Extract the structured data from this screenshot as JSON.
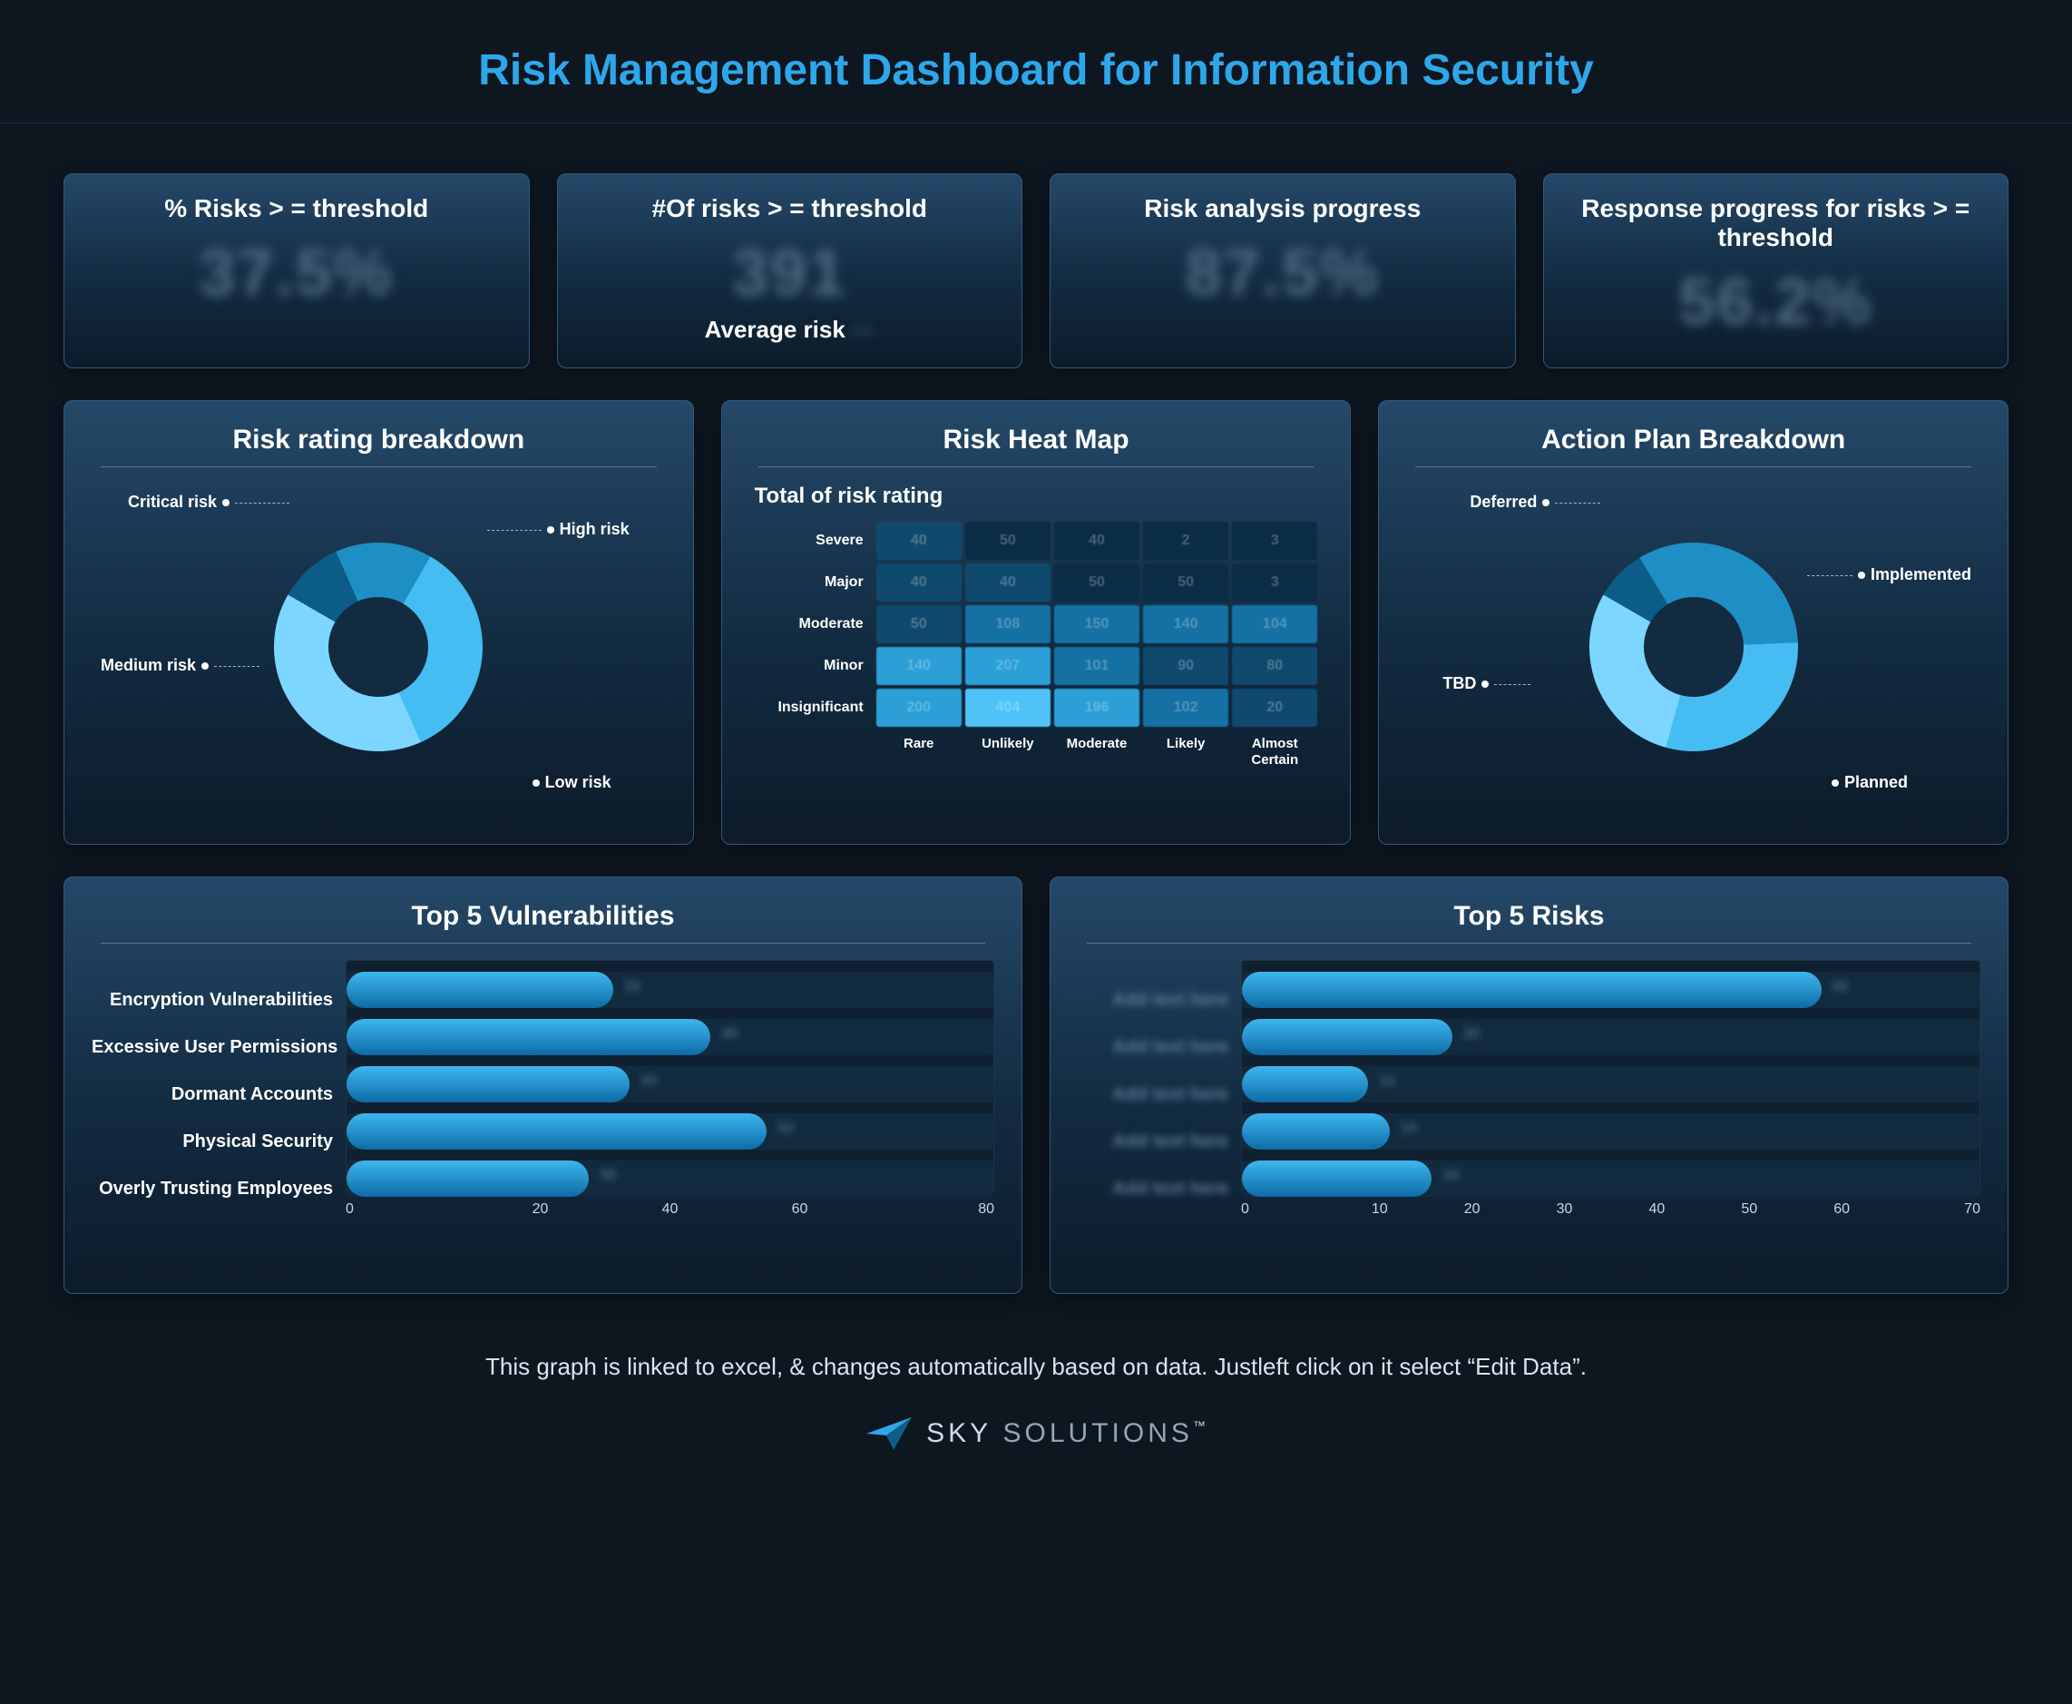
{
  "title": "Risk Management Dashboard for Information Security",
  "kpis": [
    {
      "label": "% Risks > = threshold",
      "value": "37.5%"
    },
    {
      "label": "#Of risks > = threshold",
      "value": "391",
      "sub_label": "Average risk",
      "sub_value": "—"
    },
    {
      "label": "Risk analysis progress",
      "value": "87.5%"
    },
    {
      "label": "Response progress for risks > = threshold",
      "value": "56.2%"
    }
  ],
  "risk_rating": {
    "title": "Risk rating breakdown",
    "segments": [
      {
        "name": "Critical risk",
        "pct": 10
      },
      {
        "name": "High risk",
        "pct": 15
      },
      {
        "name": "Low risk",
        "pct": 35
      },
      {
        "name": "Medium risk",
        "pct": 40
      }
    ]
  },
  "heatmap": {
    "title": "Risk Heat Map",
    "subtitle": "Total of risk rating",
    "rows": [
      "Severe",
      "Major",
      "Moderate",
      "Minor",
      "Insignificant"
    ],
    "cols": [
      "Rare",
      "Unlikely",
      "Moderate",
      "Likely",
      "Almost Certain"
    ],
    "cells": [
      [
        40,
        50,
        40,
        2,
        3
      ],
      [
        40,
        40,
        50,
        50,
        3
      ],
      [
        50,
        108,
        150,
        140,
        104
      ],
      [
        140,
        207,
        101,
        90,
        80
      ],
      [
        200,
        404,
        196,
        102,
        20
      ]
    ],
    "palette_scale": [
      [
        1,
        0,
        0,
        0,
        0
      ],
      [
        1,
        1,
        0,
        0,
        0
      ],
      [
        1,
        2,
        2,
        2,
        2
      ],
      [
        3,
        3,
        2,
        1,
        1
      ],
      [
        3,
        4,
        3,
        2,
        1
      ]
    ]
  },
  "action_plan": {
    "title": "Action Plan Breakdown",
    "segments": [
      {
        "name": "Deferred",
        "pct": 8
      },
      {
        "name": "Implemented",
        "pct": 33
      },
      {
        "name": "Planned",
        "pct": 30
      },
      {
        "name": "TBD",
        "pct": 29
      }
    ]
  },
  "top_vulnerabilities": {
    "title": "Top 5 Vulnerabilities",
    "xmax": 80,
    "ticks": [
      0,
      20,
      40,
      60,
      80
    ],
    "items": [
      {
        "label": "Encryption Vulnerabilities",
        "value": 33
      },
      {
        "label": "Excessive User Permissions",
        "value": 45
      },
      {
        "label": "Dormant Accounts",
        "value": 35
      },
      {
        "label": "Physical Security",
        "value": 52
      },
      {
        "label": "Overly Trusting Employees",
        "value": 30
      }
    ]
  },
  "top_risks": {
    "title": "Top 5 Risks",
    "xmax": 70,
    "ticks": [
      0,
      10,
      20,
      30,
      40,
      50,
      60,
      70
    ],
    "items": [
      {
        "label": "Add text here",
        "value": 55
      },
      {
        "label": "Add text here",
        "value": 20
      },
      {
        "label": "Add text here",
        "value": 12
      },
      {
        "label": "Add text here",
        "value": 14
      },
      {
        "label": "Add text here",
        "value": 18
      }
    ]
  },
  "footnote": "This graph is linked to excel, & changes automatically based on data. Justleft click on it select “Edit Data”.",
  "brand": {
    "a": "SKY",
    "b": "SOLUTIONS",
    "tm": "™"
  },
  "chart_data": [
    {
      "type": "pie",
      "title": "Risk rating breakdown",
      "series": [
        {
          "name": "Critical risk",
          "value": 10
        },
        {
          "name": "High risk",
          "value": 15
        },
        {
          "name": "Low risk",
          "value": 35
        },
        {
          "name": "Medium risk",
          "value": 40
        }
      ]
    },
    {
      "type": "heatmap",
      "title": "Risk Heat Map — Total of risk rating",
      "x": [
        "Rare",
        "Unlikely",
        "Moderate",
        "Likely",
        "Almost Certain"
      ],
      "y": [
        "Severe",
        "Major",
        "Moderate",
        "Minor",
        "Insignificant"
      ],
      "values": [
        [
          40,
          50,
          40,
          2,
          3
        ],
        [
          40,
          40,
          50,
          50,
          3
        ],
        [
          50,
          108,
          150,
          140,
          104
        ],
        [
          140,
          207,
          101,
          90,
          80
        ],
        [
          200,
          404,
          196,
          102,
          20
        ]
      ]
    },
    {
      "type": "pie",
      "title": "Action Plan Breakdown",
      "series": [
        {
          "name": "Deferred",
          "value": 8
        },
        {
          "name": "Implemented",
          "value": 33
        },
        {
          "name": "Planned",
          "value": 30
        },
        {
          "name": "TBD",
          "value": 29
        }
      ]
    },
    {
      "type": "bar",
      "title": "Top 5 Vulnerabilities",
      "orientation": "horizontal",
      "categories": [
        "Encryption Vulnerabilities",
        "Excessive User Permissions",
        "Dormant Accounts",
        "Physical Security",
        "Overly Trusting Employees"
      ],
      "values": [
        33,
        45,
        35,
        52,
        30
      ],
      "xlabel": "",
      "ylabel": "",
      "xlim": [
        0,
        80
      ]
    },
    {
      "type": "bar",
      "title": "Top 5 Risks",
      "orientation": "horizontal",
      "categories": [
        "Add text here",
        "Add text here",
        "Add text here",
        "Add text here",
        "Add text here"
      ],
      "values": [
        55,
        20,
        12,
        14,
        18
      ],
      "xlabel": "",
      "ylabel": "",
      "xlim": [
        0,
        70
      ]
    }
  ]
}
